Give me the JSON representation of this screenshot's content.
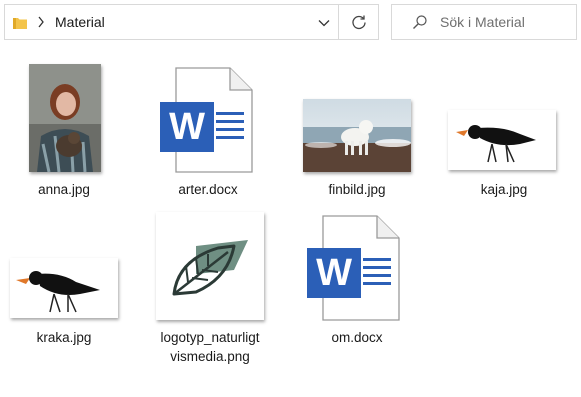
{
  "address_bar": {
    "path": "Material"
  },
  "search": {
    "placeholder": "Sök i Material"
  },
  "files": [
    {
      "name": "anna.jpg"
    },
    {
      "name": "arter.docx"
    },
    {
      "name": "finbild.jpg"
    },
    {
      "name": "kaja.jpg"
    },
    {
      "name": "kraka.jpg"
    },
    {
      "name": "logotyp_naturligtvismedia.png",
      "line1": "logotyp_naturligt",
      "line2": "vismedia.png"
    },
    {
      "name": "om.docx"
    }
  ],
  "colors": {
    "word_blue": "#2b5fb7",
    "leaf_green": "#6f8f83",
    "leaf_outline": "#2b3a36",
    "folder_yellow": "#f3c44b"
  }
}
